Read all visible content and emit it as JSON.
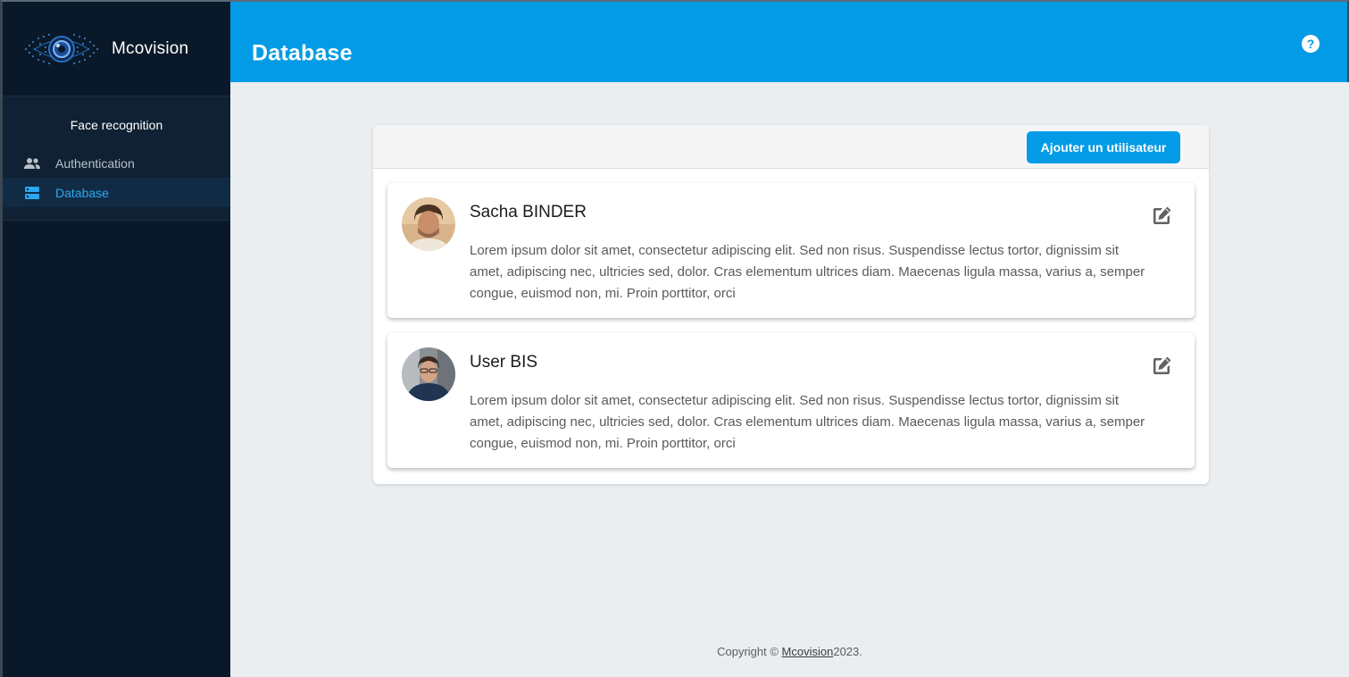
{
  "app": {
    "name": "Mcovision"
  },
  "sidebar": {
    "section_title": "Face recognition",
    "items": [
      {
        "label": "Authentication",
        "icon": "people-icon",
        "active": false
      },
      {
        "label": "Database",
        "icon": "storage-icon",
        "active": true
      }
    ]
  },
  "header": {
    "title": "Database",
    "help_icon": "help-circle-icon"
  },
  "toolbar": {
    "add_user_label": "Ajouter un utilisateur"
  },
  "users": [
    {
      "name": "Sacha BINDER",
      "description": "Lorem ipsum dolor sit amet, consectetur adipiscing elit. Sed non risus. Suspendisse lectus tortor, dignissim sit amet, adipiscing nec, ultricies sed, dolor. Cras elementum ultrices diam. Maecenas ligula massa, varius a, semper congue, euismod non, mi. Proin porttitor, orci"
    },
    {
      "name": "User BIS",
      "description": "Lorem ipsum dolor sit amet, consectetur adipiscing elit. Sed non risus. Suspendisse lectus tortor, dignissim sit amet, adipiscing nec, ultricies sed, dolor. Cras elementum ultrices diam. Maecenas ligula massa, varius a, semper congue, euismod non, mi. Proin porttitor, orci"
    }
  ],
  "footer": {
    "prefix": "Copyright © ",
    "link": "Mcovision",
    "suffix": "2023."
  },
  "colors": {
    "primary": "#039be5",
    "sidebar_bg": "#0a1929",
    "active_text": "#2ba8f0",
    "content_bg": "#eaeef1"
  }
}
